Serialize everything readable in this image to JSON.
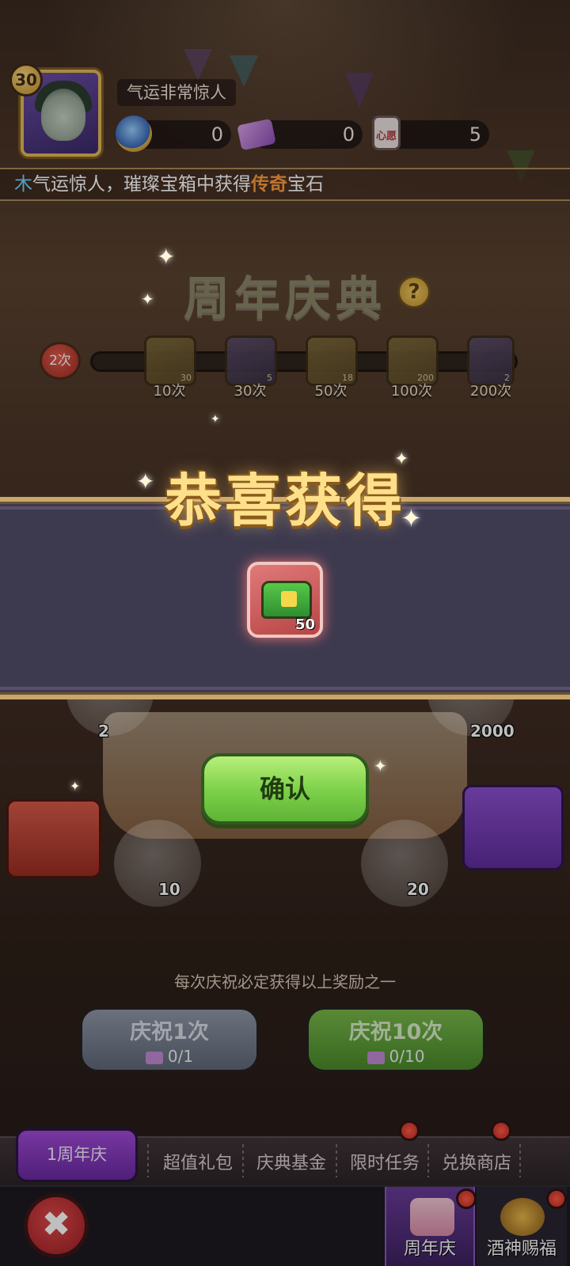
{
  "player": {
    "level": "30",
    "lucky_label": "气运非常惊人"
  },
  "resources": [
    {
      "icon": "gem-coin-icon",
      "value": "0"
    },
    {
      "icon": "ticket-icon",
      "value": "0"
    },
    {
      "icon": "heart-tag-icon",
      "value": "5",
      "tag_text": "心愿"
    }
  ],
  "marquee": {
    "name": "木",
    "pre": "气运惊人，璀璨宝箱中获得",
    "rare": "传奇",
    "post": "宝石"
  },
  "event": {
    "title": "周年庆典",
    "help": "?",
    "count": "2次",
    "milestones": [
      {
        "label": "10次",
        "qty": "30",
        "icon": "heart-tag-icon"
      },
      {
        "label": "30次",
        "qty": "5",
        "icon": "key-icon"
      },
      {
        "label": "50次",
        "qty": "18",
        "icon": "gold-gem-icon"
      },
      {
        "label": "100次",
        "qty": "200",
        "icon": "heart-tag-icon"
      },
      {
        "label": "200次",
        "qty": "2",
        "icon": "key-icon"
      }
    ]
  },
  "popup": {
    "title": "恭喜获得",
    "reward": {
      "icon": "green-chest-icon",
      "qty": "50"
    },
    "confirm_label": "确认"
  },
  "pool": {
    "items": [
      {
        "qty": "2",
        "icon": "badge-icon"
      },
      {
        "qty": "2000",
        "icon": "gold-gem-icon"
      },
      {
        "qty": "10",
        "icon": "crown-ticket-icon"
      },
      {
        "qty": "20",
        "icon": "heart-tag-icon"
      }
    ],
    "hint": "每次庆祝必定获得以上奖励之一"
  },
  "actions": {
    "once": {
      "label": "庆祝1次",
      "cost": "0/1"
    },
    "ten": {
      "label": "庆祝10次",
      "cost": "0/10"
    }
  },
  "tabs": [
    {
      "label": "1周年庆",
      "active": true
    },
    {
      "label": "超值礼包"
    },
    {
      "label": "庆典基金"
    },
    {
      "label": "限时任务",
      "dot": true
    },
    {
      "label": "兑换商店",
      "dot": true
    }
  ],
  "nav": {
    "close": "✖",
    "items": [
      {
        "label": "周年庆",
        "active": true
      },
      {
        "label": "酒神赐福"
      }
    ]
  },
  "colors": {
    "popup_band": "#3d3a4f",
    "accent_gold": "#ffe08a",
    "confirm_green": "#7fd24b",
    "rare_orange": "#ff9a3c",
    "name_cyan": "#6fd8ff"
  }
}
